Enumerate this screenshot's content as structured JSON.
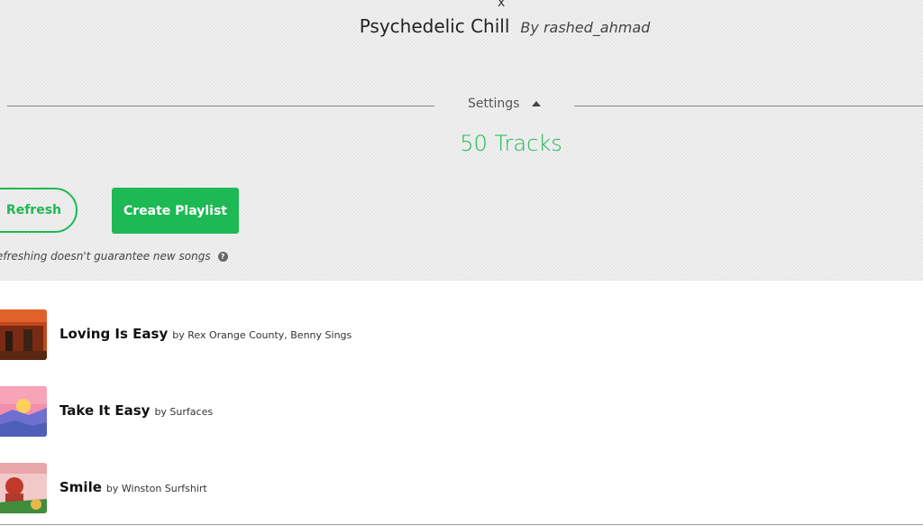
{
  "header": {
    "close_label": "x",
    "playlist_name": "Psychedelic Chill",
    "author": "By rashed_ahmad"
  },
  "settings": {
    "label": "Settings"
  },
  "tracks_count": "50 Tracks",
  "actions": {
    "refresh_label": "Refresh",
    "create_label": "Create Playlist",
    "hint": "efreshing doesn't guarantee new songs"
  },
  "tracks": [
    {
      "name": "Loving Is Easy",
      "by": "by Rex Orange County, Benny Sings"
    },
    {
      "name": "Take It Easy",
      "by": "by Surfaces"
    },
    {
      "name": "Smile",
      "by": "by Winston Surfshirt"
    }
  ],
  "colors": {
    "accent": "#1db954"
  }
}
